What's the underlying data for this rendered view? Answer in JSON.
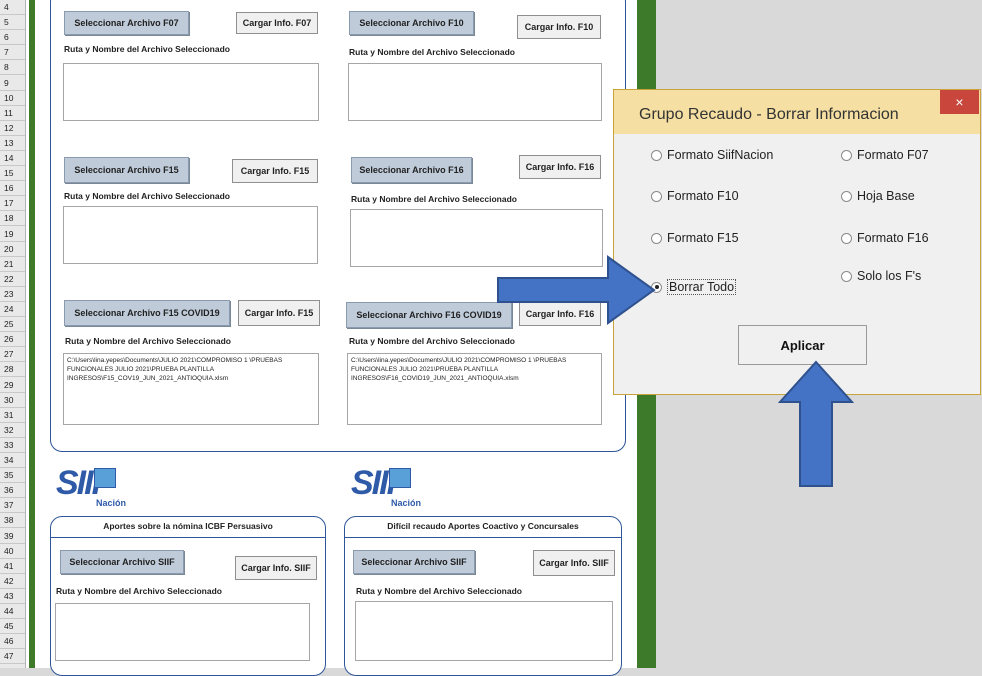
{
  "rows": [
    "4",
    "5",
    "6",
    "7",
    "8",
    "9",
    "10",
    "11",
    "12",
    "13",
    "14",
    "15",
    "16",
    "17",
    "18",
    "19",
    "20",
    "21",
    "22",
    "23",
    "24",
    "25",
    "26",
    "27",
    "28",
    "29",
    "30",
    "31",
    "32",
    "33",
    "34",
    "35",
    "36",
    "37",
    "38",
    "39",
    "40",
    "41",
    "42",
    "43",
    "44",
    "45",
    "46",
    "47"
  ],
  "sections": {
    "f07": {
      "select": "Seleccionar Archivo F07",
      "load": "Cargar Info. F07",
      "path_label": "Ruta y Nombre del Archivo Seleccionado",
      "path": ""
    },
    "f10": {
      "select": "Seleccionar Archivo F10",
      "load": "Cargar Info. F10",
      "path_label": "Ruta y Nombre del Archivo Seleccionado",
      "path": ""
    },
    "f15": {
      "select": "Seleccionar Archivo F15",
      "load": "Cargar Info. F15",
      "path_label": "Ruta y Nombre del Archivo Seleccionado",
      "path": ""
    },
    "f16": {
      "select": "Seleccionar Archivo F16",
      "load": "Cargar Info. F16",
      "path_label": "Ruta y Nombre del Archivo Seleccionado",
      "path": ""
    },
    "f15c": {
      "select": "Seleccionar Archivo F15 COVID19",
      "load": "Cargar Info. F15",
      "path_label": "Ruta y Nombre del Archivo Seleccionado",
      "path": "C:\\Users\\lina.yepes\\Documents\\JULIO 2021\\COMPROMISO 1 \\PRUEBAS FUNCIONALES JULIO 2021\\PRUEBA PLANTILLA INGRESOS\\F15_COV19_JUN_2021_ANTIOQUIA.xlsm"
    },
    "f16c": {
      "select": "Seleccionar Archivo F16 COVID19",
      "load": "Cargar Info. F16",
      "path_label": "Ruta y Nombre del Archivo Seleccionado",
      "path": "C:\\Users\\lina.yepes\\Documents\\JULIO 2021\\COMPROMISO 1 \\PRUEBAS FUNCIONALES JULIO 2021\\PRUEBA PLANTILLA INGRESOS\\F16_COVID19_JUN_2021_ANTIOQUIA.xlsm"
    },
    "siif1": {
      "title": "Aportes sobre la nómina ICBF Persuasivo",
      "select": "Seleccionar Archivo SIIF",
      "load": "Cargar Info. SIIF",
      "path_label": "Ruta y Nombre del Archivo Seleccionado"
    },
    "siif2": {
      "title": "Difícil recaudo Aportes Coactivo y Concursales",
      "select": "Seleccionar Archivo SIIF",
      "load": "Cargar Info. SIIF",
      "path_label": "Ruta y Nombre del Archivo Seleccionado"
    }
  },
  "logo": {
    "text": "SIIF",
    "sub": "Nación"
  },
  "dialog": {
    "title": "Grupo Recaudo - Borrar Informacion",
    "close": "×",
    "options": {
      "siif": "Formato SiifNacion",
      "f07": "Formato F07",
      "f10": "Formato F10",
      "base": "Hoja Base",
      "f15": "Formato F15",
      "f16": "Formato F16",
      "todo": "Borrar Todo",
      "fs": "Solo los F's"
    },
    "selected": "Borrar Todo",
    "apply": "Aplicar"
  },
  "colors": {
    "arrow": "#4472c4",
    "panel_border": "#2e5597",
    "green": "#3d7b2a",
    "titlebar": "#f5dfa2"
  },
  "icons": [
    "right-arrow-icon",
    "up-arrow-icon",
    "close-icon"
  ]
}
